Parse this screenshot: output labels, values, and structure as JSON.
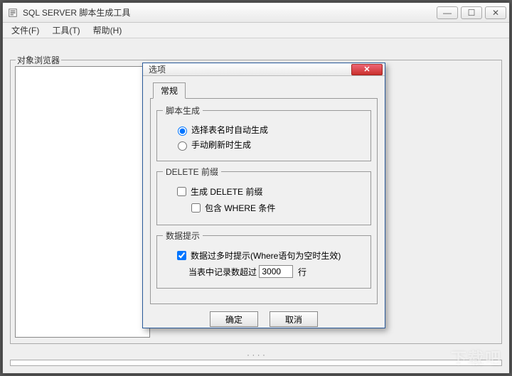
{
  "window": {
    "title": "SQL SERVER 脚本生成工具",
    "controls": {
      "min": "—",
      "max": "☐",
      "close": "✕"
    }
  },
  "menu": {
    "file": "文件(F)",
    "tools": "工具(T)",
    "help": "帮助(H)"
  },
  "sidebar": {
    "label": "对象浏览器"
  },
  "dialog": {
    "title": "选项",
    "close_glyph": "✕",
    "tab_general": "常规",
    "group_script": {
      "legend": "脚本生成",
      "opt_auto": "选择表名时自动生成",
      "opt_manual": "手动刷新时生成",
      "selected": "auto"
    },
    "group_delete": {
      "legend": "DELETE 前缀",
      "gen_delete": "生成 DELETE 前缀",
      "gen_delete_checked": false,
      "include_where": "包含 WHERE 条件",
      "include_where_checked": false
    },
    "group_data": {
      "legend": "数据提示",
      "warn_label": "数据过多时提示(Where语句为空时生效)",
      "warn_checked": true,
      "rows_prefix": "当表中记录数超过",
      "rows_value": "3000",
      "rows_suffix": "行"
    },
    "buttons": {
      "ok": "确定",
      "cancel": "取消"
    }
  },
  "watermark": "下载吧"
}
